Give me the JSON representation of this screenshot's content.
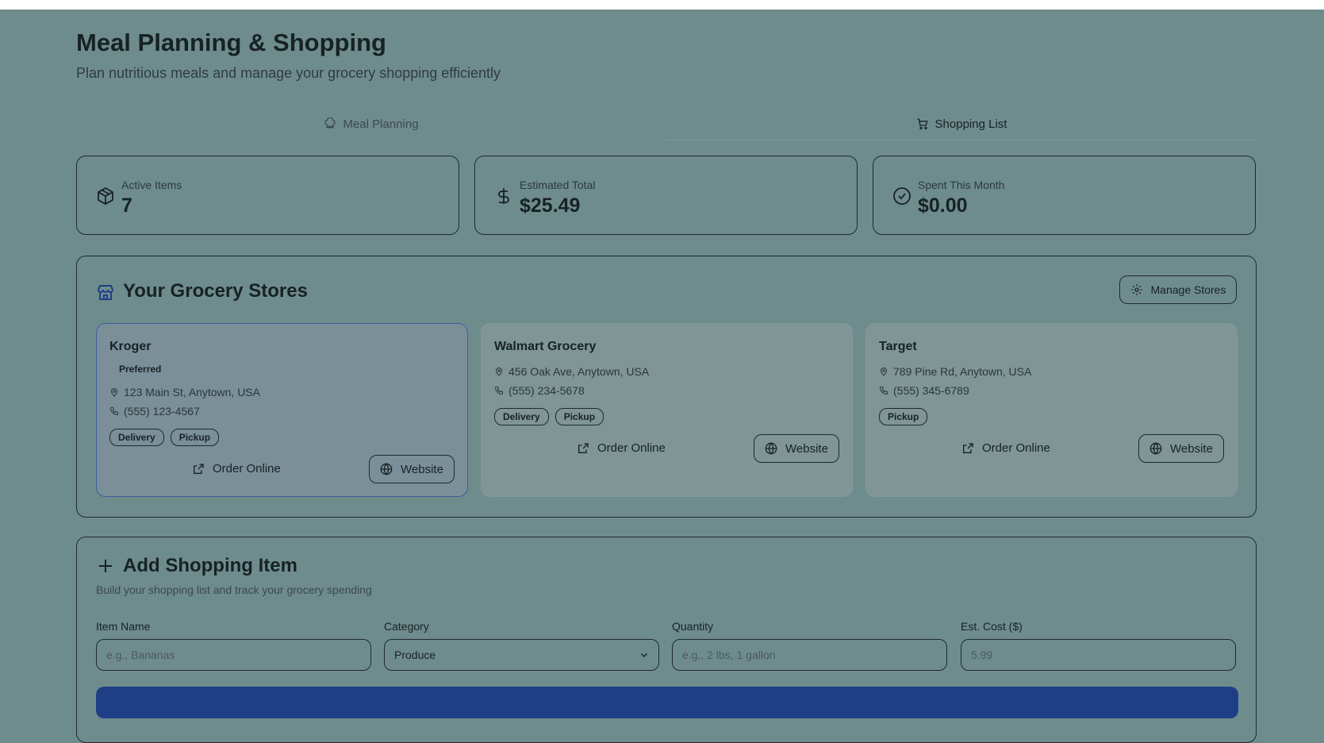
{
  "header": {
    "title": "Meal Planning & Shopping",
    "subtitle": "Plan nutritious meals and manage your grocery shopping efficiently"
  },
  "tabs": [
    {
      "label": "Meal Planning",
      "icon": "chef-hat-icon",
      "active": false
    },
    {
      "label": "Shopping List",
      "icon": "cart-icon",
      "active": true
    }
  ],
  "stats": [
    {
      "label": "Active Items",
      "value": "7",
      "icon": "package-icon"
    },
    {
      "label": "Estimated Total",
      "value": "$25.49",
      "icon": "dollar-icon"
    },
    {
      "label": "Spent This Month",
      "value": "$0.00",
      "icon": "check-circle-icon"
    }
  ],
  "stores_section": {
    "title": "Your Grocery Stores",
    "icon": "store-icon",
    "manage_label": "Manage Stores",
    "stores": [
      {
        "name": "Kroger",
        "preferred_label": "Preferred",
        "address": "123 Main St, Anytown, USA",
        "phone": "(555) 123-4567",
        "services": [
          "Delivery",
          "Pickup"
        ],
        "order_label": "Order Online",
        "website_label": "Website"
      },
      {
        "name": "Walmart Grocery",
        "address": "456 Oak Ave, Anytown, USA",
        "phone": "(555) 234-5678",
        "services": [
          "Delivery",
          "Pickup"
        ],
        "order_label": "Order Online",
        "website_label": "Website"
      },
      {
        "name": "Target",
        "address": "789 Pine Rd, Anytown, USA",
        "phone": "(555) 345-6789",
        "services": [
          "Pickup"
        ],
        "order_label": "Order Online",
        "website_label": "Website"
      }
    ]
  },
  "add_item": {
    "title": "Add Shopping Item",
    "subtitle": "Build your shopping list and track your grocery spending",
    "fields": {
      "item_name": {
        "label": "Item Name",
        "placeholder": "e.g., Bananas"
      },
      "category": {
        "label": "Category",
        "value": "Produce"
      },
      "quantity": {
        "label": "Quantity",
        "placeholder": "e.g., 2 lbs, 1 gallon"
      },
      "cost": {
        "label": "Est. Cost ($)",
        "placeholder": "5.99"
      }
    }
  },
  "colors": {
    "background": "#6f8c8d",
    "accent": "#1e3f86",
    "preferred_border": "#3d5f9e"
  }
}
